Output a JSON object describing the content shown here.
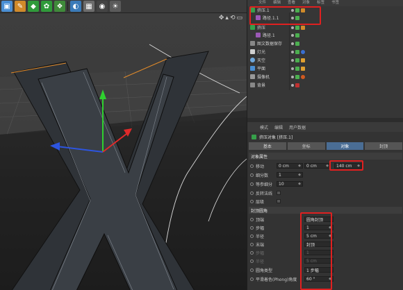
{
  "toolbar": {
    "icons": [
      {
        "name": "cube-icon",
        "color": "#4a8fd4"
      },
      {
        "name": "pen-icon",
        "color": "#d08a2a"
      },
      {
        "name": "subdivision-icon",
        "color": "#2f9a3a"
      },
      {
        "name": "cloner-icon",
        "color": "#2f9a3a"
      },
      {
        "name": "deformer-icon",
        "color": "#3f8a3a"
      },
      {
        "name": "environment-icon",
        "color": "#3a7ab8"
      },
      {
        "name": "floor-grid-icon",
        "color": "#6d6d6d"
      },
      {
        "name": "camera-icon",
        "color": "#444444"
      },
      {
        "name": "light-icon",
        "color": "#5a5a5a"
      }
    ]
  },
  "object_manager": {
    "menu": [
      "文件",
      "编辑",
      "查看",
      "对象",
      "标签",
      "书签"
    ],
    "objects": [
      {
        "name": "挤压.1",
        "icon_color": "#36a04a",
        "indent": 0
      },
      {
        "name": "路径.1.1",
        "icon_color": "#9b59b6",
        "indent": 1
      },
      {
        "name": "挤压",
        "icon_color": "#36a04a",
        "indent": 0
      },
      {
        "name": "路径.1",
        "icon_color": "#9b59b6",
        "indent": 1
      },
      {
        "name": "图文数据保存",
        "icon_color": "#888888",
        "indent": 0
      },
      {
        "name": "灯光",
        "icon_color": "#d0d0d0",
        "indent": 0
      },
      {
        "name": "天空",
        "icon_color": "#6fa8dc",
        "indent": 0
      },
      {
        "name": "平面",
        "icon_color": "#4a8fd4",
        "indent": 0
      },
      {
        "name": "摄像机",
        "icon_color": "#999999",
        "indent": 0
      },
      {
        "name": "背景",
        "icon_color": "#888888",
        "indent": 0
      }
    ]
  },
  "attributes": {
    "menu": [
      "模式",
      "编辑",
      "用户数据"
    ],
    "title": "挤压对象 [挤压.1]",
    "tabs": [
      {
        "label": "基本",
        "active": false
      },
      {
        "label": "坐标",
        "active": false
      },
      {
        "label": "对象",
        "active": true
      },
      {
        "label": "封顶",
        "active": false
      }
    ],
    "object_section": {
      "header": "对象属性",
      "move_label": "移动",
      "move_values": [
        "0 cm",
        "0 cm",
        "140 cm"
      ],
      "subdiv_label": "细分数",
      "subdiv_value": "1",
      "isoparm_label": "等参细分",
      "isoparm_value": "10",
      "flip_label": "反转法线",
      "hier_label": "层级"
    },
    "caps_section": {
      "header": "封顶圆角",
      "rows": [
        {
          "label": "顶端",
          "value": "圆角封顶",
          "dim": false
        },
        {
          "label": "步幅",
          "value": "1",
          "dim": false
        },
        {
          "label": "半径",
          "value": "5 cm",
          "dim": false
        },
        {
          "label": "末端",
          "value": "封顶",
          "dim": false
        },
        {
          "label": "步幅",
          "value": "1",
          "dim": true
        },
        {
          "label": "半径",
          "value": "5 cm",
          "dim": true
        },
        {
          "label": "圆角类型",
          "value": "1 步幅",
          "dim": false
        },
        {
          "label": "平滑着色(Phong)角度",
          "value": "60 °",
          "dim": false
        }
      ]
    }
  },
  "highlight_color": "#e02020"
}
